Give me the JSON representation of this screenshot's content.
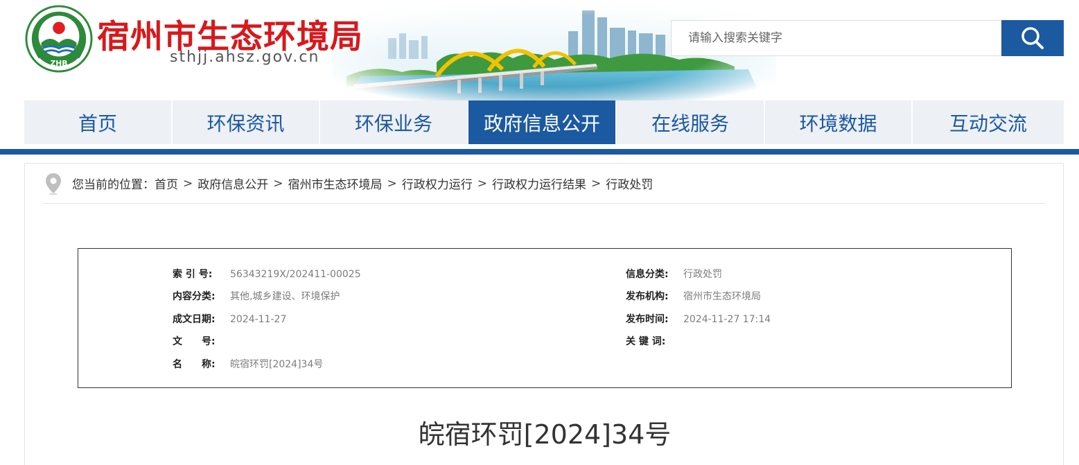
{
  "header": {
    "site_title": "宿州市生态环境局",
    "site_domain": "sthjj.ahsz.gov.cn",
    "logo_text": "ZHB",
    "search_placeholder": "请输入搜索关键字",
    "search_icon": "search-icon"
  },
  "nav": {
    "items": [
      {
        "label": "首页",
        "active": false
      },
      {
        "label": "环保资讯",
        "active": false
      },
      {
        "label": "环保业务",
        "active": false
      },
      {
        "label": "政府信息公开",
        "active": true
      },
      {
        "label": "在线服务",
        "active": false
      },
      {
        "label": "环境数据",
        "active": false
      },
      {
        "label": "互动交流",
        "active": false
      }
    ]
  },
  "breadcrumb": {
    "prefix": "您当前的位置：",
    "separator": ">",
    "items": [
      "首页",
      "政府信息公开",
      "宿州市生态环境局",
      "行政权力运行",
      "行政权力运行结果",
      "行政处罚"
    ]
  },
  "meta": {
    "index_label": "索 引 号:",
    "index_value": "56343219X/202411-00025",
    "category_label": "内容分类:",
    "category_value": "其他,城乡建设、环境保护",
    "date_label": "成文日期:",
    "date_value": "2024-11-27",
    "docno_label": "文　　号:",
    "docno_value": "",
    "name_label": "名　　称:",
    "name_value": "皖宿环罚[2024]34号",
    "info_type_label": "信息分类:",
    "info_type_value": "行政处罚",
    "publisher_label": "发布机构:",
    "publisher_value": "宿州市生态环境局",
    "pub_time_label": "发布时间:",
    "pub_time_value": "2024-11-27 17:14",
    "keywords_label": "关 键 词:",
    "keywords_value": ""
  },
  "document": {
    "title": "皖宿环罚[2024]34号"
  },
  "colors": {
    "brand_blue": "#1b59a1",
    "title_red": "#d7191c",
    "nav_bg": "#edf0f4"
  }
}
